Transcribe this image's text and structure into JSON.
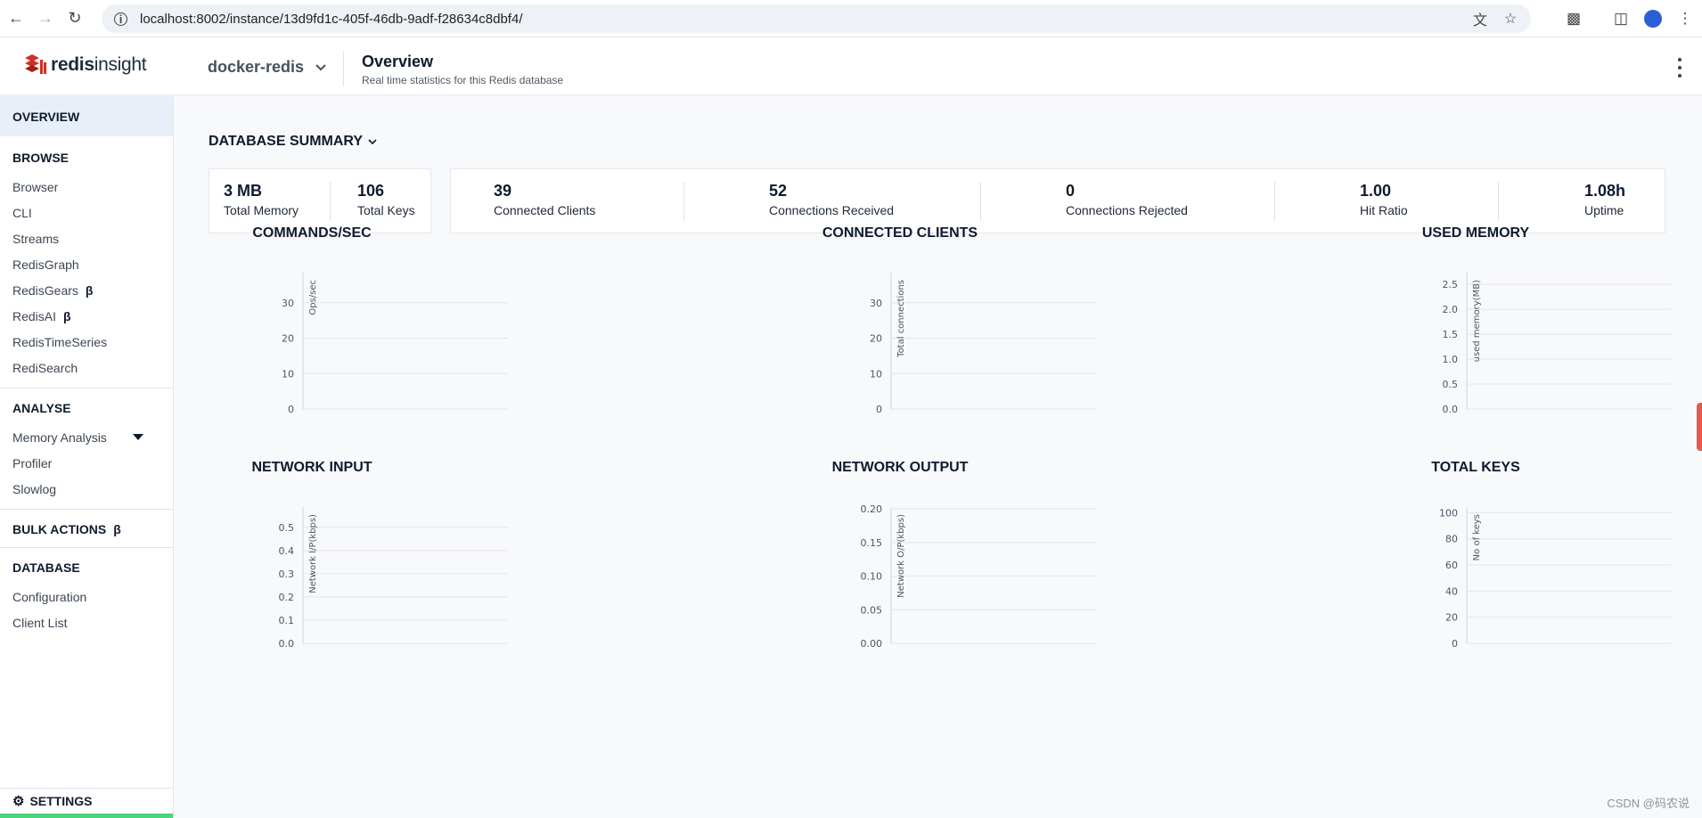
{
  "browser": {
    "url": "localhost:8002/instance/13d9fd1c-405f-46db-9adf-f28634c8dbf4/"
  },
  "header": {
    "logo_bold": "redis",
    "logo_rest": "insight",
    "database": "docker-redis",
    "title": "Overview",
    "subtitle": "Real time statistics for this Redis database"
  },
  "sidebar": {
    "overview": "OVERVIEW",
    "browse": {
      "heading": "BROWSE",
      "items": [
        "Browser",
        "CLI",
        "Streams",
        "RedisGraph",
        "RedisGears",
        "RedisAI",
        "RedisTimeSeries",
        "RediSearch"
      ]
    },
    "beta_symbol": "β",
    "analyse": {
      "heading": "ANALYSE",
      "items": [
        "Memory Analysis",
        "Profiler",
        "Slowlog"
      ]
    },
    "bulk_actions": "BULK ACTIONS",
    "database": {
      "heading": "DATABASE",
      "items": [
        "Configuration",
        "Client List"
      ]
    },
    "settings": "SETTINGS"
  },
  "summary": {
    "title": "DATABASE SUMMARY",
    "memory": {
      "value": "3 MB",
      "label": "Total Memory"
    },
    "keys": {
      "value": "106",
      "label": "Total Keys"
    },
    "clients": {
      "value": "39",
      "label": "Connected Clients"
    },
    "received": {
      "value": "52",
      "label": "Connections Received"
    },
    "rejected": {
      "value": "0",
      "label": "Connections Rejected"
    },
    "hit_ratio": {
      "value": "1.00",
      "label": "Hit Ratio"
    },
    "uptime": {
      "value": "1.08h",
      "label": "Uptime"
    }
  },
  "chart_data": [
    {
      "type": "line",
      "title": "COMMANDS/SEC",
      "ylabel": "Ops/sec",
      "yticks": [
        "0",
        "10",
        "20",
        "30"
      ],
      "ylim": [
        0,
        38
      ],
      "grid": true,
      "series": []
    },
    {
      "type": "line",
      "title": "CONNECTED CLIENTS",
      "ylabel": "Total connections",
      "yticks": [
        "0",
        "10",
        "20",
        "30"
      ],
      "ylim": [
        0,
        38
      ],
      "grid": true,
      "series": []
    },
    {
      "type": "line",
      "title": "USED MEMORY",
      "ylabel": "used memory(MB)",
      "yticks": [
        "0.0",
        "0.5",
        "1.0",
        "1.5",
        "2.0",
        "2.5"
      ],
      "ylim": [
        0,
        2.7
      ],
      "grid": true,
      "series": []
    },
    {
      "type": "line",
      "title": "NETWORK INPUT",
      "ylabel": "Network I/P(kbps)",
      "yticks": [
        "0.0",
        "0.1",
        "0.2",
        "0.3",
        "0.4",
        "0.5"
      ],
      "ylim": [
        0,
        0.58
      ],
      "grid": true,
      "series": []
    },
    {
      "type": "line",
      "title": "NETWORK OUTPUT",
      "ylabel": "Network O/P(kbps)",
      "yticks": [
        "0.00",
        "0.05",
        "0.10",
        "0.15",
        "0.20"
      ],
      "ylim": [
        0,
        0.2
      ],
      "grid": true,
      "series": []
    },
    {
      "type": "line",
      "title": "TOTAL KEYS",
      "ylabel": "No of keys",
      "yticks": [
        "0",
        "20",
        "40",
        "60",
        "80",
        "100"
      ],
      "ylim": [
        0,
        103
      ],
      "grid": true,
      "series": []
    }
  ],
  "watermark": "CSDN @码农说"
}
